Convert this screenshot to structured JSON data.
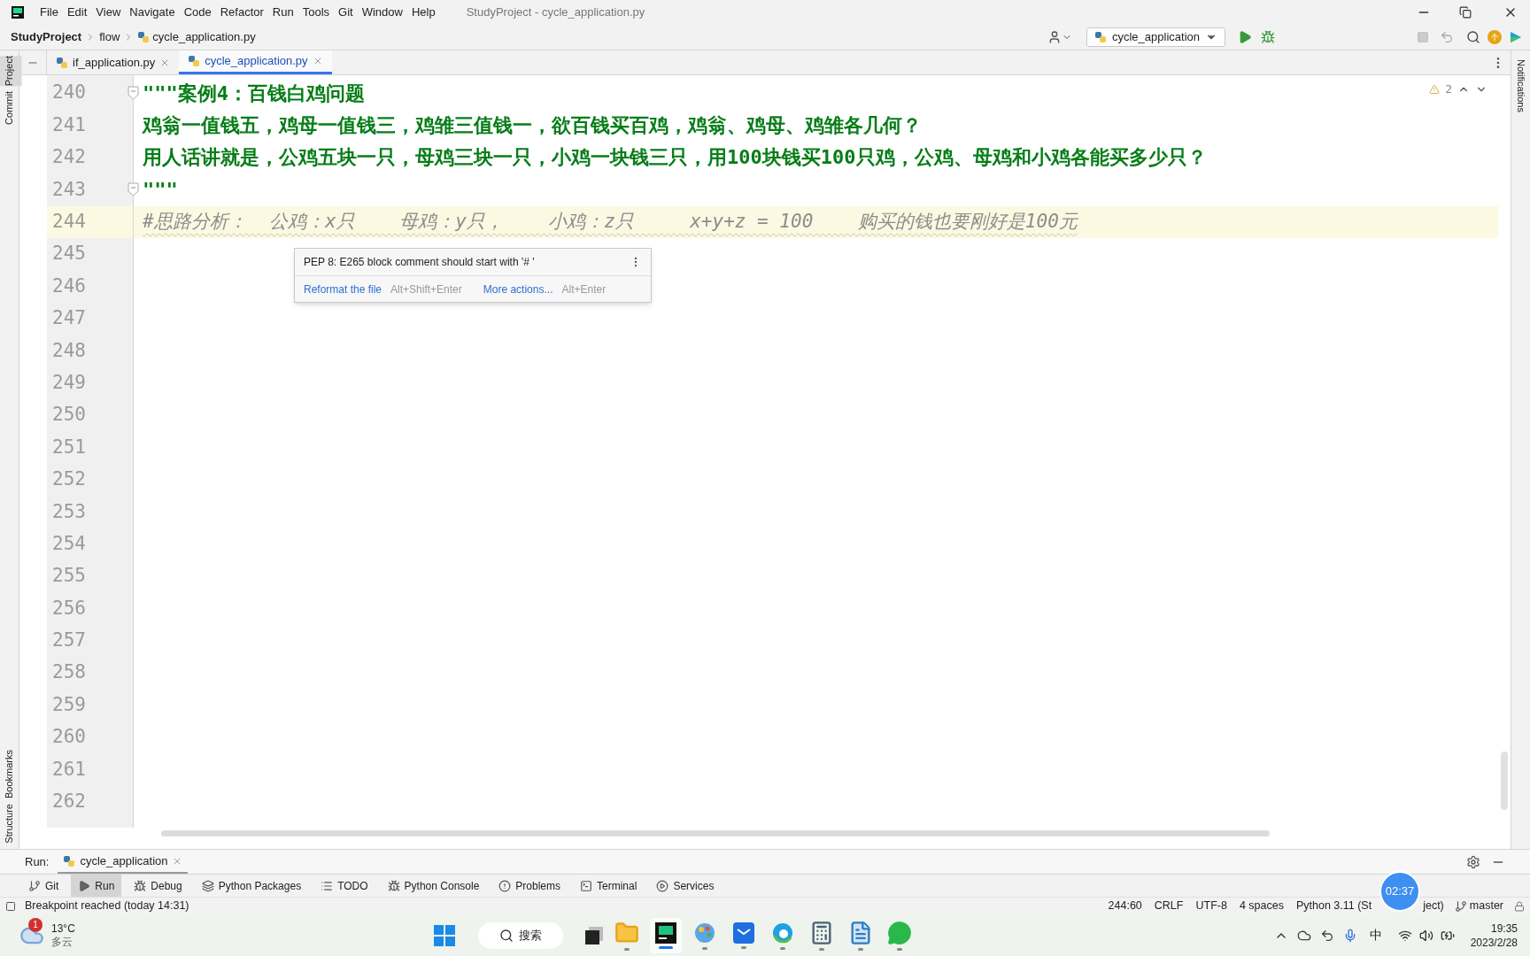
{
  "window": {
    "title": "StudyProject - cycle_application.py"
  },
  "menu": [
    "File",
    "Edit",
    "View",
    "Navigate",
    "Code",
    "Refactor",
    "Run",
    "Tools",
    "Git",
    "Window",
    "Help"
  ],
  "breadcrumbs": [
    "StudyProject",
    "flow",
    "cycle_application.py"
  ],
  "run_config": "cycle_application",
  "left_strip": {
    "top": [
      {
        "label": "Project",
        "selected": true
      },
      {
        "label": "Commit",
        "selected": false
      }
    ],
    "bottom": [
      "Bookmarks",
      "Structure"
    ]
  },
  "right_strip": [
    "Notifications"
  ],
  "tabs": [
    {
      "label": "if_application.py",
      "selected": false
    },
    {
      "label": "cycle_application.py",
      "selected": true
    }
  ],
  "warnings": "2",
  "code_lines": [
    {
      "number": "240",
      "kind": "docstring",
      "text": "\"\"\"案例4：百钱白鸡问题",
      "fold": true,
      "current": false
    },
    {
      "number": "241",
      "kind": "docstring",
      "text": "鸡翁一值钱五，鸡母一值钱三，鸡雏三值钱一，欲百钱买百鸡，鸡翁、鸡母、鸡雏各几何？",
      "fold": false,
      "current": false
    },
    {
      "number": "242",
      "kind": "docstring",
      "text": "用人话讲就是，公鸡五块一只，母鸡三块一只，小鸡一块钱三只，用**100**块钱买**100**只鸡，公鸡、母鸡和小鸡各能买多少只？",
      "fold": false,
      "current": false
    },
    {
      "number": "243",
      "kind": "docstring",
      "text": "\"\"\"",
      "fold": true,
      "current": false
    },
    {
      "number": "244",
      "kind": "comment",
      "text": "#思路分析：  公鸡：x只    母鸡：y只，    小鸡：z只     x+y+z = 100    购买的钱也要刚好是100元",
      "fold": false,
      "current": true
    },
    {
      "number": "245",
      "kind": "empty",
      "fold": false,
      "current": false
    },
    {
      "number": "246",
      "kind": "empty",
      "fold": false,
      "current": false
    },
    {
      "number": "247",
      "kind": "empty",
      "fold": false,
      "current": false
    },
    {
      "number": "248",
      "kind": "empty",
      "fold": false,
      "current": false
    },
    {
      "number": "249",
      "kind": "empty",
      "fold": false,
      "current": false
    },
    {
      "number": "250",
      "kind": "empty",
      "fold": false,
      "current": false
    },
    {
      "number": "251",
      "kind": "empty",
      "fold": false,
      "current": false
    },
    {
      "number": "252",
      "kind": "empty",
      "fold": false,
      "current": false
    },
    {
      "number": "253",
      "kind": "empty",
      "fold": false,
      "current": false
    },
    {
      "number": "254",
      "kind": "empty",
      "fold": false,
      "current": false
    },
    {
      "number": "255",
      "kind": "empty",
      "fold": false,
      "current": false
    },
    {
      "number": "256",
      "kind": "empty",
      "fold": false,
      "current": false
    },
    {
      "number": "257",
      "kind": "empty",
      "fold": false,
      "current": false
    },
    {
      "number": "258",
      "kind": "empty",
      "fold": false,
      "current": false
    },
    {
      "number": "259",
      "kind": "empty",
      "fold": false,
      "current": false
    },
    {
      "number": "260",
      "kind": "empty",
      "fold": false,
      "current": false
    },
    {
      "number": "261",
      "kind": "empty",
      "fold": false,
      "current": false
    },
    {
      "number": "262",
      "kind": "empty",
      "fold": false,
      "current": false
    }
  ],
  "popup": {
    "message": "PEP 8: E265 block comment should start with '# '",
    "actions": [
      {
        "label": "Reformat the file",
        "shortcut": "Alt+Shift+Enter"
      },
      {
        "label": "More actions...",
        "shortcut": "Alt+Enter"
      }
    ]
  },
  "run_panel": {
    "label": "Run:",
    "tab": "cycle_application"
  },
  "tool_tabs": [
    {
      "label": "Git",
      "kind": "git",
      "selected": false
    },
    {
      "label": "Run",
      "kind": "run",
      "selected": true
    },
    {
      "label": "Debug",
      "kind": "debug",
      "selected": false
    },
    {
      "label": "Python Packages",
      "kind": "packages",
      "selected": false
    },
    {
      "label": "TODO",
      "kind": "todo",
      "selected": false
    },
    {
      "label": "Python Console",
      "kind": "console",
      "selected": false
    },
    {
      "label": "Problems",
      "kind": "problems",
      "selected": false
    },
    {
      "label": "Terminal",
      "kind": "terminal",
      "selected": false
    },
    {
      "label": "Services",
      "kind": "services",
      "selected": false
    }
  ],
  "status_bar": {
    "message": "Breakpoint reached (today 14:31)",
    "items": [
      "244:60",
      "CRLF",
      "UTF-8",
      "4 spaces"
    ],
    "interpreter_start": "Python 3.11 (St",
    "interpreter_end": "ject)",
    "branch": "master"
  },
  "recorder_badge": "02:37",
  "taskbar": {
    "temperature": "13°C",
    "condition": "多云",
    "badge": "1",
    "search": "搜索",
    "apps": [
      {
        "kind": "files",
        "selected": false
      },
      {
        "kind": "pycharm",
        "selected": true
      },
      {
        "kind": "paint",
        "selected": false
      },
      {
        "kind": "mail",
        "selected": false
      },
      {
        "kind": "edge",
        "selected": false
      },
      {
        "kind": "calculator",
        "selected": false
      },
      {
        "kind": "notepad",
        "selected": false
      },
      {
        "kind": "wechat",
        "selected": false
      }
    ],
    "ime": "中",
    "time": "19:35",
    "date": "2023/2/28"
  }
}
